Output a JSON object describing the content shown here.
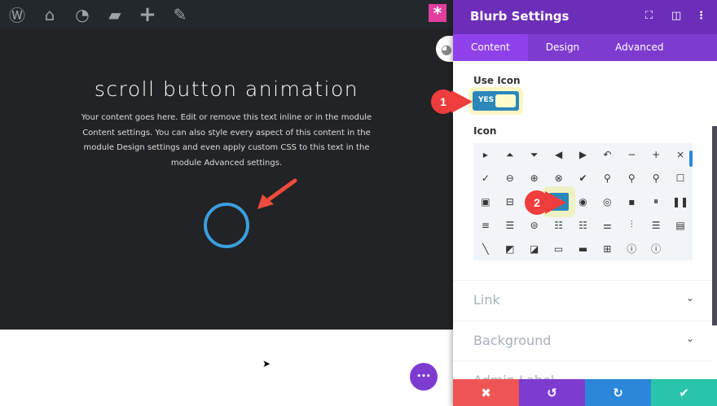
{
  "admin_bar": {
    "icons": [
      "wordpress-icon",
      "my-sites-icon",
      "dashboard-icon",
      "comments-icon",
      "add-new-icon",
      "edit-icon"
    ]
  },
  "hero": {
    "title": "scroll button animation",
    "body": "Your content goes here. Edit or remove this text inline or in the module Content settings. You can also style every aspect of this content in the module Design settings and even apply custom CSS to this text in the module Advanced settings."
  },
  "panel": {
    "title": "Blurb Settings",
    "tabs": [
      {
        "label": "Content",
        "active": true
      },
      {
        "label": "Design"
      },
      {
        "label": "Advanced"
      }
    ],
    "use_icon": {
      "label": "Use Icon",
      "value": "YES"
    },
    "icon": {
      "label": "Icon",
      "selected": "circle-outline",
      "glyphs": [
        "▸",
        "⏶",
        "⏷",
        "◀",
        "▶",
        "↶",
        "−",
        "+",
        "×",
        "✓",
        "⊖",
        "⊕",
        "⊗",
        "✔",
        "⚲",
        "⚲",
        "⚲",
        "☐",
        "▣",
        "⊟",
        "✓",
        "○",
        "◉",
        "◎",
        "▪",
        "⏸",
        "❚❚",
        "≡",
        "☰",
        "⊜",
        "☷",
        "☷",
        "⚌",
        "⫶",
        "☰",
        "▤",
        "╲",
        "◩",
        "◪",
        "▭",
        "▬",
        "⊞",
        "ⓘ",
        "ⓘ"
      ]
    },
    "sections": [
      {
        "label": "Link"
      },
      {
        "label": "Background"
      },
      {
        "label": "Admin Label"
      }
    ],
    "footer": {
      "cancel": "✖",
      "undo": "↺",
      "redo": "↻",
      "save": "✔"
    }
  },
  "annotations": {
    "step1": "1",
    "step2": "2"
  },
  "more_button": "•••",
  "colors": {
    "header": "#6c2eb9",
    "tabs": "#7e3bd0",
    "accent": "#2b87ba",
    "cancel": "#ef5555",
    "undo": "#7e3bd0",
    "redo": "#2b87da",
    "save": "#29c4a9",
    "circle": "#3a9fe0"
  }
}
